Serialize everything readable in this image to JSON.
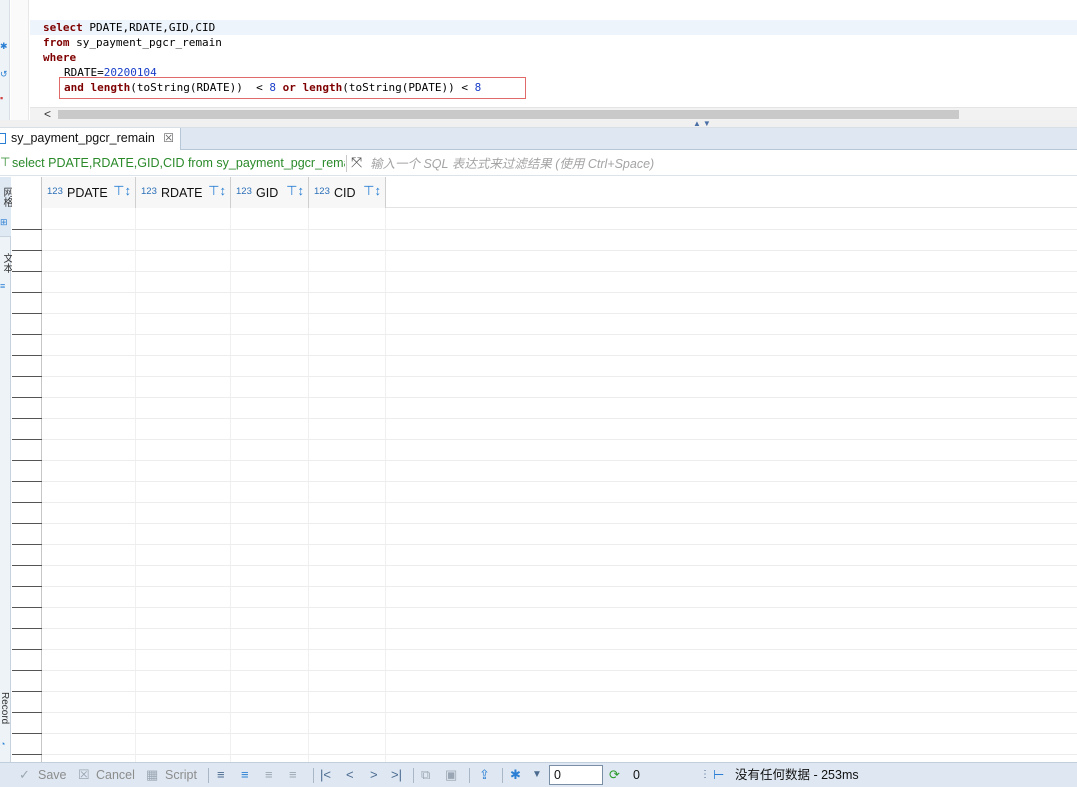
{
  "editor": {
    "lines": [
      {
        "kw": "select",
        "rest": " PDATE,RDATE,GID,CID"
      },
      {
        "kw": "from",
        "rest": " sy_payment_pgcr_remain"
      },
      {
        "kw": "where",
        "rest": ""
      }
    ],
    "line4_text": "RDATE=",
    "line4_num": "20200104",
    "line5": {
      "kw_and": "and",
      "p1": " length(toString(RDATE))  < ",
      "n1": "8",
      "kw_or": " or",
      "p2": " length(toString(PDATE)) < ",
      "n2": "8"
    },
    "scroll_left_glyph": "<"
  },
  "results_tab": {
    "label": "sy_payment_pgcr_remain",
    "close_glyph": "☒"
  },
  "filter": {
    "query_text": "select PDATE,RDATE,GID,CID from sy_payment_pgcr_remain",
    "placeholder": "输入一个 SQL 表达式来过滤结果 (使用 Ctrl+Space)"
  },
  "side_tabs": {
    "grid_label": "网格",
    "text_label": "文本",
    "record_label": "Record"
  },
  "grid": {
    "columns": [
      {
        "type": "123",
        "name": "PDATE"
      },
      {
        "type": "123",
        "name": "RDATE"
      },
      {
        "type": "123",
        "name": "GID"
      },
      {
        "type": "123",
        "name": "CID"
      }
    ]
  },
  "toolbar": {
    "save_label": "Save",
    "cancel_label": "Cancel",
    "script_label": "Script",
    "offset_value": "0",
    "fetched_count": "0",
    "status": "没有任何数据 - 253ms"
  },
  "colors": {
    "keyword": "#7f0000",
    "number": "#1a3fc9",
    "highlight_border": "#e06a6a",
    "query_green": "#2a8a2a"
  },
  "icons": [
    "filter-icon",
    "expand-icon",
    "grid-icon",
    "text-icon",
    "record-icon",
    "save-icon",
    "cancel-icon",
    "script-icon",
    "first-page-icon",
    "prev-page-icon",
    "next-page-icon",
    "last-page-icon",
    "export-icon",
    "settings-icon",
    "refresh-icon",
    "panels-icon"
  ]
}
